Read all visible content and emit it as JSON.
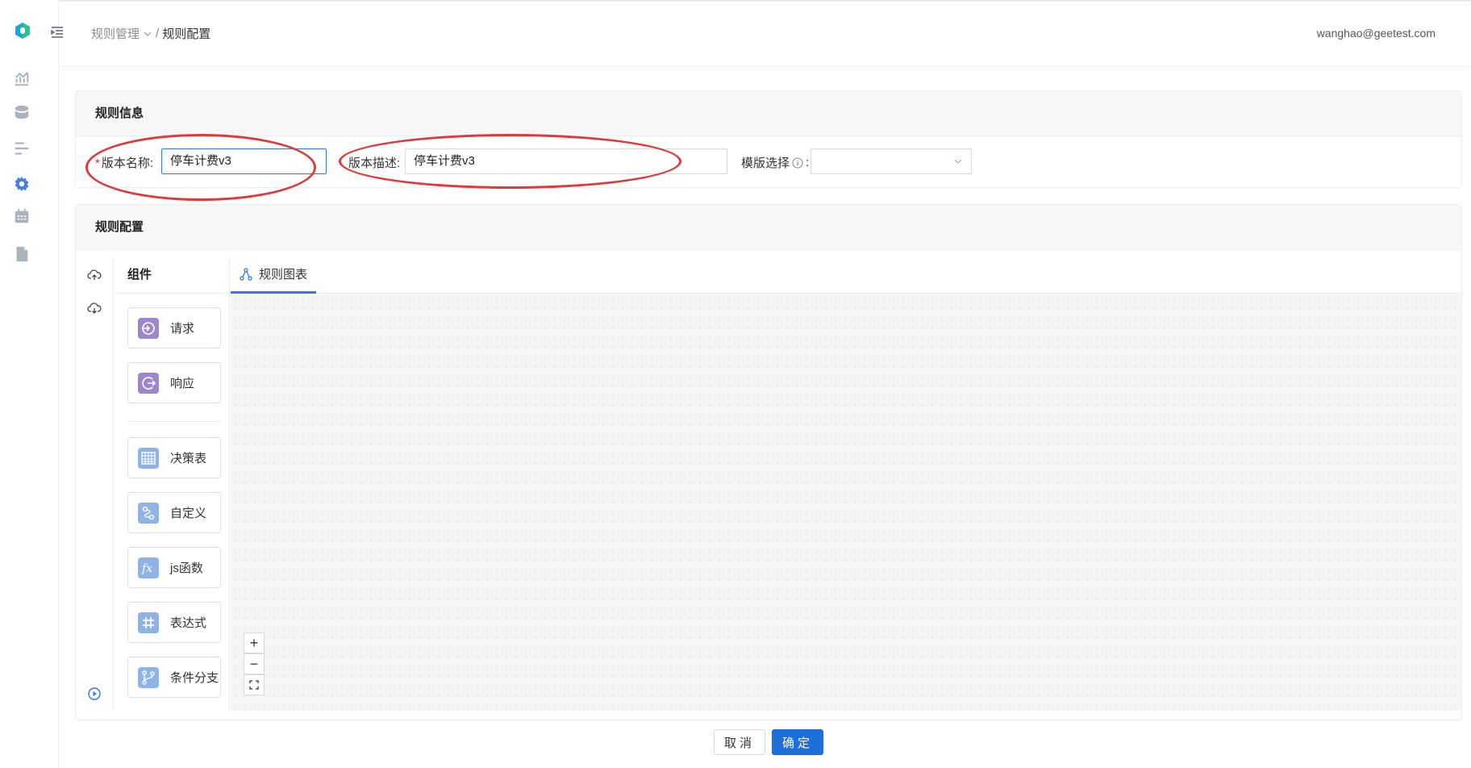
{
  "breadcrumb": {
    "parent": "规则管理",
    "current": "规则配置"
  },
  "user": {
    "email": "wanghao@geetest.com"
  },
  "rule_info": {
    "title": "规则信息",
    "version_name_label": "版本名称:",
    "version_name_value": "停车计费v3",
    "version_desc_label": "版本描述:",
    "version_desc_value": "停车计费v3",
    "template_label": "模版选择",
    "template_value": ""
  },
  "rule_config": {
    "title": "规则配置",
    "palette_title": "组件",
    "components": [
      {
        "label": "请求",
        "icon": "request-icon",
        "color": "#9b87c9"
      },
      {
        "label": "响应",
        "icon": "response-icon",
        "color": "#9b87c9"
      },
      {
        "label": "决策表",
        "icon": "table-icon",
        "color": "#8fb3e6"
      },
      {
        "label": "自定义",
        "icon": "custom-icon",
        "color": "#8fb3e6"
      },
      {
        "label": "js函数",
        "icon": "function-icon",
        "color": "#8fb3e6"
      },
      {
        "label": "表达式",
        "icon": "hash-icon",
        "color": "#8fb3e6"
      },
      {
        "label": "条件分支",
        "icon": "branch-icon",
        "color": "#8fb3e6"
      }
    ],
    "tab_label": "规则图表",
    "zoom_in": "+",
    "zoom_out": "−"
  },
  "buttons": {
    "cancel": "取消",
    "confirm": "确定"
  },
  "colors": {
    "primary": "#1e6fd9",
    "annotation": "#e0393c"
  }
}
